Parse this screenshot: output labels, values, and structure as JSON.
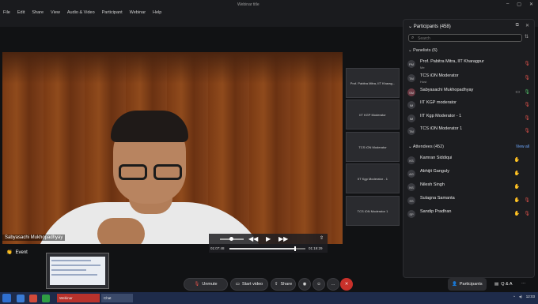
{
  "window": {
    "title": "Webinar title"
  },
  "menu": [
    "File",
    "Edit",
    "Share",
    "View",
    "Audio & Video",
    "Participant",
    "Webinar",
    "Help"
  ],
  "video": {
    "speaker_name": "Sabyasachi Mukhopadhyay"
  },
  "player": {
    "elapsed": "01:07:48",
    "total": "01:19:29",
    "progress": 0.85,
    "volume": 0.4
  },
  "tiles": [
    "Prof. Pabitra Mitra, IIT Kharag...",
    "IIT KGP Moderator",
    "TCS iON Moderator",
    "IIT Kgp Moderator - 1",
    "TCS iON Moderator 1"
  ],
  "participants": {
    "title": "Participants (458)",
    "search_placeholder": "Search",
    "panelists_title": "Panelists (6)",
    "panelists": [
      {
        "initials": "PM",
        "name": "Prof. Pabitra Mitra, IIT Kharagpur",
        "role": "Me"
      },
      {
        "initials": "TM",
        "name": "TCS iON Moderator",
        "role": "Host"
      },
      {
        "initials": "SM",
        "name": "Sabyasachi Mukhopadhyay",
        "role": ""
      },
      {
        "initials": "IM",
        "name": "IIT KGP moderator",
        "role": ""
      },
      {
        "initials": "IM",
        "name": "IIT Kgp Moderator - 1",
        "role": ""
      },
      {
        "initials": "TM",
        "name": "TCS iON Moderator 1",
        "role": ""
      }
    ],
    "attendees_title": "Attendees (452)",
    "view_all": "View all",
    "attendees": [
      {
        "initials": "KS",
        "name": "Kamran Siddiqui"
      },
      {
        "initials": "AG",
        "name": "Abhijit Ganguly"
      },
      {
        "initials": "NS",
        "name": "Nilesh Singh"
      },
      {
        "initials": "SS",
        "name": "Sulagna Samanta"
      },
      {
        "initials": "SP",
        "name": "Sandip Pradhan"
      }
    ]
  },
  "bottom": {
    "reaction_label": "Event",
    "unmute": "Unmute",
    "start_video": "Start video",
    "share": "Share",
    "more": "...",
    "participants_btn": "Participants",
    "qa_btn": "Q & A"
  },
  "taskbar": {
    "items": [
      "Webinar",
      "Chat",
      ""
    ],
    "time": "12:03"
  },
  "colors": {
    "accent": "#6ea8ff",
    "danger": "#e0524a",
    "panel": "#1c1d20"
  }
}
